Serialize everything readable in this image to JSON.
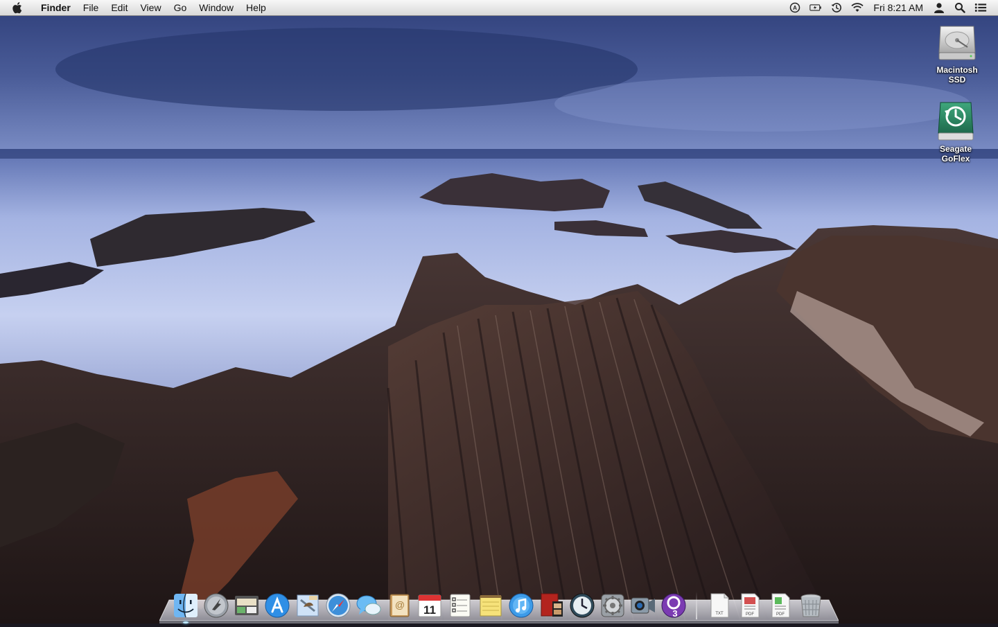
{
  "menubar": {
    "app_name": "Finder",
    "menus": [
      "File",
      "Edit",
      "View",
      "Go",
      "Window",
      "Help"
    ],
    "status_icons": [
      "adobe-icon",
      "battery-icon",
      "time-machine-icon",
      "wifi-icon"
    ],
    "clock": "Fri 8:21 AM",
    "right_icons": [
      "user-icon",
      "spotlight-icon",
      "notification-center-icon"
    ]
  },
  "desktop": {
    "icons": [
      {
        "label": "Macintosh\nSSD",
        "icon": "hard-drive-icon"
      },
      {
        "label": "Seagate\nGoFlex",
        "icon": "time-machine-drive-icon"
      }
    ]
  },
  "dock": {
    "apps": [
      "finder-icon",
      "launchpad-icon",
      "image-capture-icon",
      "app-store-icon",
      "mail-icon",
      "safari-icon",
      "messages-icon",
      "contacts-icon",
      "calendar-icon",
      "reminders-icon",
      "notes-icon",
      "itunes-icon",
      "photo-booth-icon",
      "time-machine-icon",
      "system-preferences-icon",
      "facetime-icon",
      "instastats-icon"
    ],
    "calendar_day": "11",
    "docs": [
      "txt-document-icon",
      "pdf-document-icon",
      "pdf-document-icon-2",
      "trash-icon"
    ],
    "doc_labels": [
      "TXT",
      "PDF",
      "PDF"
    ]
  },
  "colors": {
    "sky": "#3d4f8a",
    "sea": "#aab7e0",
    "rock": "#3a2a28",
    "menubar": "#e8e8e8"
  }
}
